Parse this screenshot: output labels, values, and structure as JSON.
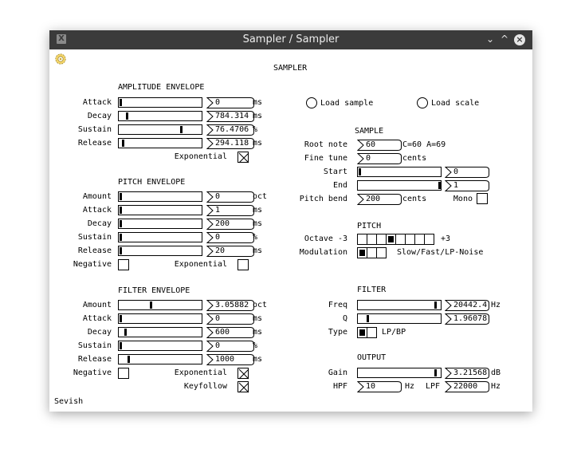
{
  "window": {
    "title": "Sampler / Sampler",
    "minimize_glyph": "⌄",
    "maximize_glyph": "^",
    "close_glyph": "×",
    "app_icon": "X"
  },
  "plugin_title": "SAMPLER",
  "footer": "Sevish",
  "amp": {
    "heading": "AMPLITUDE ENVELOPE",
    "rows": [
      {
        "label": "Attack",
        "value": "0",
        "unit": "ms",
        "level": 0.0
      },
      {
        "label": "Decay",
        "value": "784.314",
        "unit": "ms",
        "level": 0.08
      },
      {
        "label": "Sustain",
        "value": "76.4706",
        "unit": "%",
        "level": 0.76
      },
      {
        "label": "Release",
        "value": "294.118",
        "unit": "ms",
        "level": 0.03
      }
    ],
    "exponential_label": "Exponential",
    "exponential": true
  },
  "pitch_env": {
    "heading": "PITCH ENVELOPE",
    "rows": [
      {
        "label": "Amount",
        "value": "0",
        "unit": "oct",
        "level": 0.0
      },
      {
        "label": "Attack",
        "value": "1",
        "unit": "ms",
        "level": 0.0
      },
      {
        "label": "Decay",
        "value": "200",
        "unit": "ms",
        "level": 0.0
      },
      {
        "label": "Sustain",
        "value": "0",
        "unit": "%",
        "level": 0.0
      },
      {
        "label": "Release",
        "value": "20",
        "unit": "ms",
        "level": 0.0
      }
    ],
    "negative_label": "Negative",
    "negative": false,
    "exponential_label": "Exponential",
    "exponential": false
  },
  "filter_env": {
    "heading": "FILTER ENVELOPE",
    "rows": [
      {
        "label": "Amount",
        "value": "3.05882",
        "unit": "oct",
        "level": 0.38
      },
      {
        "label": "Attack",
        "value": "0",
        "unit": "ms",
        "level": 0.0
      },
      {
        "label": "Decay",
        "value": "600",
        "unit": "ms",
        "level": 0.06
      },
      {
        "label": "Sustain",
        "value": "0",
        "unit": "%",
        "level": 0.0
      },
      {
        "label": "Release",
        "value": "1000",
        "unit": "ms",
        "level": 0.1
      }
    ],
    "negative_label": "Negative",
    "negative": false,
    "exponential_label": "Exponential",
    "exponential": true,
    "keyfollow_label": "Keyfollow",
    "keyfollow": true
  },
  "load": {
    "sample_label": "Load sample",
    "scale_label": "Load scale"
  },
  "sample": {
    "heading": "SAMPLE",
    "root_note_label": "Root note",
    "root_note": "60",
    "root_note_hint": "C=60 A=69",
    "fine_tune_label": "Fine tune",
    "fine_tune": "0",
    "fine_tune_unit": "cents",
    "start_label": "Start",
    "start": "0",
    "start_level": 0.0,
    "end_label": "End",
    "end": "1",
    "end_level": 1.0,
    "pitch_bend_label": "Pitch bend",
    "pitch_bend": "200",
    "pitch_bend_unit": "cents",
    "mono_label": "Mono",
    "mono": false
  },
  "pitch": {
    "heading": "PITCH",
    "octave_label": "Octave -3",
    "octave_max_label": "+3",
    "octave_index": 3,
    "modulation_label": "Modulation",
    "modulation_options": "Slow/Fast/LP-Noise",
    "modulation_index": 0
  },
  "filter": {
    "heading": "FILTER",
    "freq_label": "Freq",
    "freq": "20442.4",
    "freq_unit": "Hz",
    "freq_level": 0.95,
    "q_label": "Q",
    "q": "1.96078",
    "q_level": 0.1,
    "type_label": "Type",
    "type_options": "LP/BP",
    "type_index": 0
  },
  "output": {
    "heading": "OUTPUT",
    "gain_label": "Gain",
    "gain": "3.21568",
    "gain_unit": "dB",
    "gain_level": 0.95,
    "hpf_label": "HPF",
    "hpf": "10",
    "hpf_unit": "Hz",
    "lpf_label": "LPF",
    "lpf": "22000",
    "lpf_unit": "Hz"
  }
}
